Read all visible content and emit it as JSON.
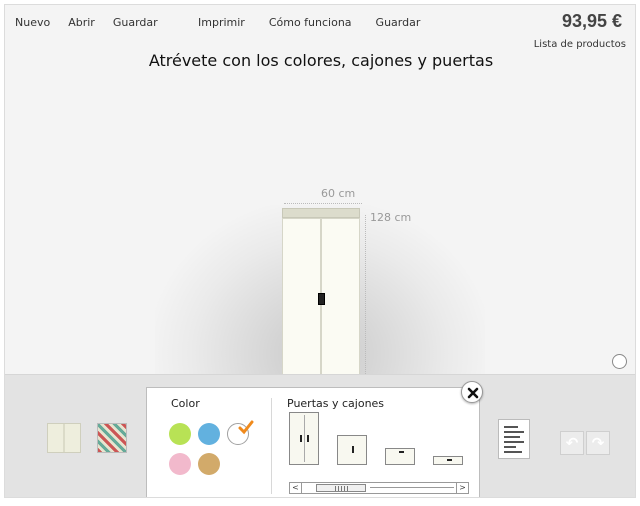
{
  "menu": {
    "left": [
      "Nuevo",
      "Abrir",
      "Guardar"
    ],
    "middle": [
      "Imprimir",
      "Cómo funciona",
      "Guardar"
    ]
  },
  "price": "93,95 €",
  "product_list_label": "Lista de productos",
  "headline": "Atrévete con los colores, cajones y puertas",
  "dimensions": {
    "width": "60 cm",
    "height": "128 cm"
  },
  "panel": {
    "color_title": "Color",
    "doors_title": "Puertas y cajones",
    "colors": [
      "#b8e255",
      "#62b1df",
      "#ffffff",
      "#f2b9cc",
      "#d2aa6a"
    ],
    "selected_color": "#ffffff",
    "scroll_left": "<",
    "scroll_right": ">",
    "close_icon": "close-icon"
  },
  "nav": {
    "undo_icon": "undo-icon",
    "redo_icon": "redo-icon"
  }
}
